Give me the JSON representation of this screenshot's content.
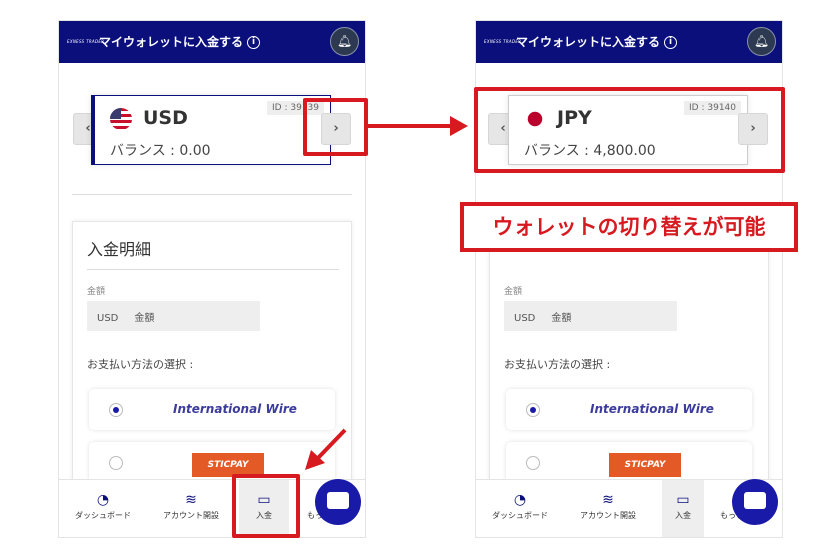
{
  "left": {
    "header": {
      "logo": "EXNESS TRADER",
      "title": "マイウォレットに入金する",
      "info_icon": "i"
    },
    "wallet": {
      "currency": "USD",
      "id": "ID : 39139",
      "balance": "バランス : 0.00",
      "flag": "us-flag"
    },
    "prev": "‹",
    "next": "›",
    "form": {
      "heading": "入金明細",
      "amount_label": "金額",
      "amount_currency": "USD",
      "amount_placeholder": "金額",
      "payment_label": "お支払い方法の選択 :",
      "options": [
        "International Wire",
        "STICPAY"
      ]
    },
    "nav": [
      "ダッシュボード",
      "アカウント開設",
      "入金",
      "もっと"
    ]
  },
  "right": {
    "header": {
      "logo": "EXNESS TRADER",
      "title": "マイウォレットに入金する",
      "info_icon": "i"
    },
    "wallet": {
      "currency": "JPY",
      "id": "ID : 39140",
      "balance": "バランス : 4,800.00",
      "flag": "jp-flag"
    },
    "prev": "‹",
    "next": "›",
    "form": {
      "amount_label": "金額",
      "amount_currency": "USD",
      "amount_placeholder": "金額",
      "payment_label": "お支払い方法の選択 :",
      "options": [
        "International Wire",
        "STICPAY"
      ]
    },
    "nav": [
      "ダッシュボード",
      "アカウント開設",
      "入金",
      "もっと"
    ]
  },
  "annotation": {
    "callout": "ウォレットの切り替えが可能",
    "color": "#d71920"
  },
  "colors": {
    "brand": "#0b0f7c",
    "sticpay": "#e45a26"
  }
}
